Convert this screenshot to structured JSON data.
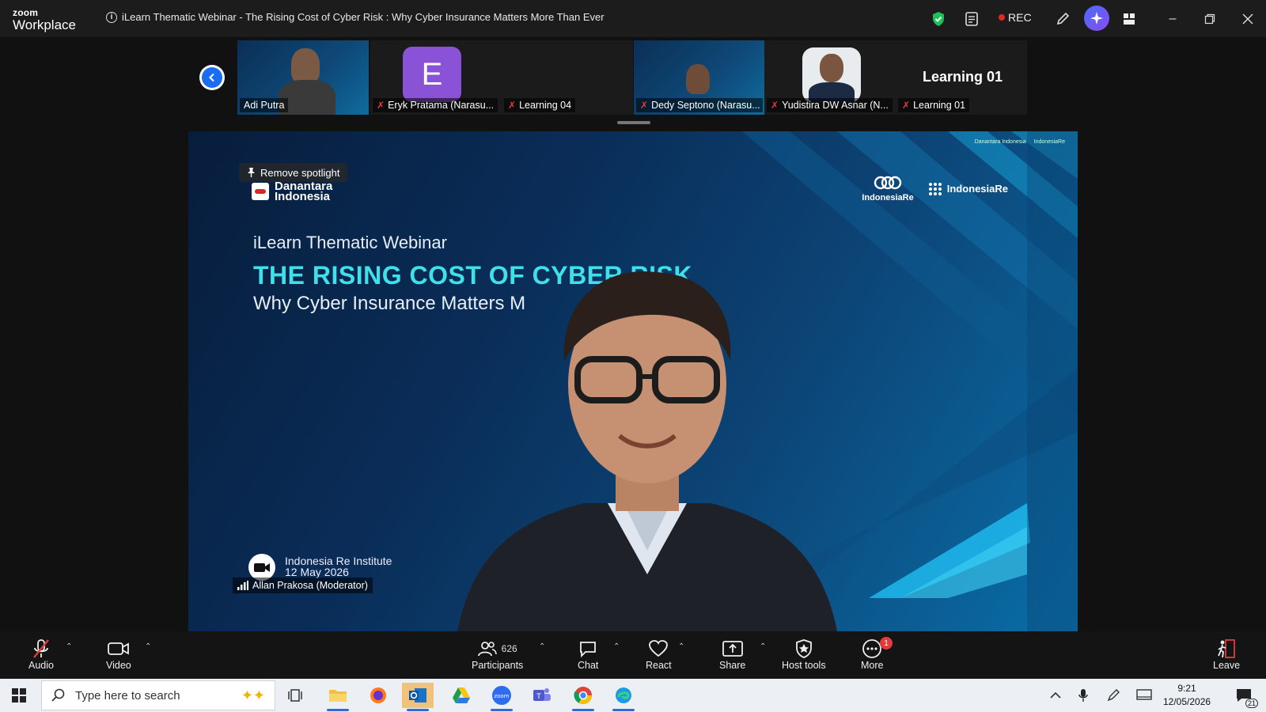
{
  "app": {
    "logo_line1": "zoom",
    "logo_line2": "Workplace"
  },
  "window": {
    "title": "iLearn Thematic Webinar - The Rising Cost of Cyber Risk : Why Cyber Insurance Matters More Than Ever",
    "rec_label": "REC"
  },
  "filmstrip": {
    "tiles": [
      {
        "name": "Adi Putra"
      },
      {
        "name": "Eryk Pratama (Narasu...",
        "avatar_letter": "E"
      },
      {
        "name": "Learning 04"
      },
      {
        "name": "Dedy Septono (Narasu..."
      },
      {
        "name": "Yudistira DW Asnar (N..."
      },
      {
        "name": "Learning 01"
      }
    ],
    "active_name": "Learning 01"
  },
  "stage": {
    "spotlight_label": "Remove spotlight",
    "brand_left": "Danantara Indonesia",
    "brand_right_1": "IndonesiaRe",
    "brand_right_2": "IndonesiaRe",
    "slide_subtitle": "iLearn Thematic Webinar",
    "slide_title": "THE RISING COST OF CYBER RISK",
    "slide_tagline": "Why Cyber Insurance Matters M",
    "footer_org": "Indonesia Re Institute",
    "footer_date": "12 May 2026",
    "speaker_name": "Allan Prakosa (Moderator)"
  },
  "toolbar": {
    "audio": "Audio",
    "video": "Video",
    "participants": "Participants",
    "participant_count": "626",
    "chat": "Chat",
    "react": "React",
    "share": "Share",
    "host_tools": "Host tools",
    "more": "More",
    "more_badge": "1",
    "leave": "Leave"
  },
  "taskbar": {
    "search_placeholder": "Type here to search",
    "time": "9:21",
    "date": "12/05/2026",
    "notif_count": "21"
  }
}
